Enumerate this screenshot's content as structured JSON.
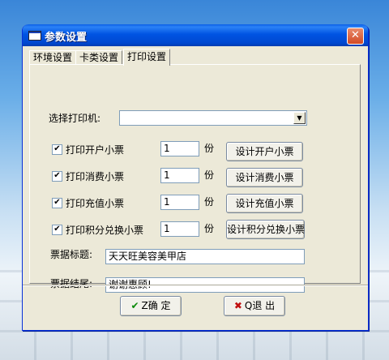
{
  "window": {
    "title": "参数设置",
    "close_glyph": "✕"
  },
  "tabs": [
    {
      "label": "环境设置",
      "active": false
    },
    {
      "label": "卡类设置",
      "active": false
    },
    {
      "label": "打印设置",
      "active": true
    }
  ],
  "printer": {
    "label": "选择打印机:",
    "value": ""
  },
  "print_rows": [
    {
      "label": "打印开户小票",
      "checked": true,
      "copies": "1",
      "unit": "份",
      "button": "设计开户小票"
    },
    {
      "label": "打印消费小票",
      "checked": true,
      "copies": "1",
      "unit": "份",
      "button": "设计消费小票"
    },
    {
      "label": "打印充值小票",
      "checked": true,
      "copies": "1",
      "unit": "份",
      "button": "设计充值小票"
    },
    {
      "label": "打印积分兑换小票",
      "checked": true,
      "copies": "1",
      "unit": "份",
      "button": "设计积分兑换小票"
    }
  ],
  "receipt_title": {
    "label": "票据标题:",
    "value": "天天旺美容美甲店"
  },
  "receipt_footer": {
    "label": "票据结尾:",
    "value": "谢谢惠顾!"
  },
  "buttons": {
    "ok": {
      "label": "Z确 定",
      "icon": "check-icon"
    },
    "cancel": {
      "label": "Q退 出",
      "icon": "x-icon"
    }
  },
  "colors": {
    "titlebar": "#0054e3",
    "dialog_bg": "#ece9d8",
    "ok_icon": "#0a8a0a",
    "cancel_icon": "#c01010"
  }
}
